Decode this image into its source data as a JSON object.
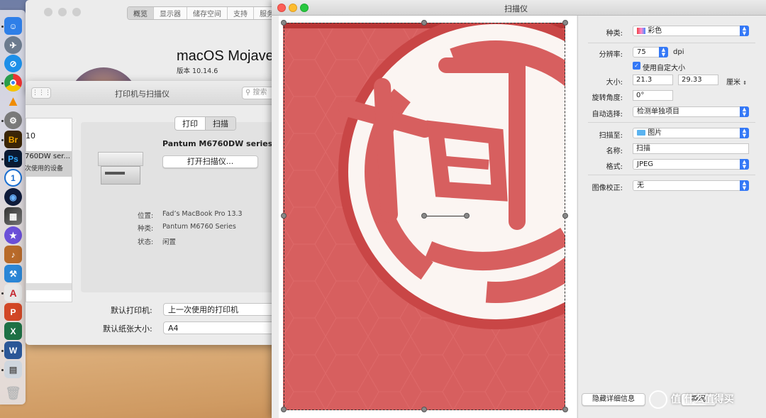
{
  "about": {
    "tabs": [
      "概览",
      "显示器",
      "储存空间",
      "支持",
      "服务"
    ],
    "os_name": "macOS Mojave",
    "version": "版本 10.14.6"
  },
  "printers_window": {
    "title": "打印机与扫描仪",
    "search_placeholder": "搜索",
    "list": {
      "item1": "10",
      "item2": "760DW ser...",
      "item2_sub": "次使用的设备"
    },
    "tabs": {
      "print": "打印",
      "scan": "扫描"
    },
    "printer_name": "Pantum M6760DW series",
    "open_scanner_button": "打开扫描仪...",
    "location_label": "位置:",
    "location_value": "Fad’s MacBook Pro 13.3",
    "kind_label": "种类:",
    "kind_value": "Pantum M6760 Series",
    "status_label": "状态:",
    "status_value": "闲置",
    "default_printer_label": "默认打印机:",
    "default_printer_value": "上一次使用的打印机",
    "paper_size_label": "默认纸张大小:",
    "paper_size_value": "A4"
  },
  "scanner": {
    "title": "扫描仪",
    "kind_label": "种类:",
    "kind_value": "彩色",
    "resolution_label": "分辨率:",
    "resolution_value": "75",
    "resolution_unit": "dpi",
    "custom_size_label": "使用自定大小",
    "custom_size_checked": true,
    "size_label": "大小:",
    "width_value": "21.3",
    "height_value": "29.33",
    "size_unit": "厘米",
    "rotation_label": "旋转角度:",
    "rotation_value": "0°",
    "auto_select_label": "自动选择:",
    "auto_select_value": "检测单独项目",
    "scan_to_label": "扫描至:",
    "scan_to_value": "图片",
    "name_label": "名称:",
    "name_value": "扫描",
    "format_label": "格式:",
    "format_value": "JPEG",
    "correction_label": "图像校正:",
    "correction_value": "无",
    "hide_details_button": "隐藏详细信息",
    "overview_button": "概况"
  },
  "watermark": "值 什么值得买",
  "colors": {
    "accent": "#3478f6",
    "scan_red": "#d75f5f"
  }
}
